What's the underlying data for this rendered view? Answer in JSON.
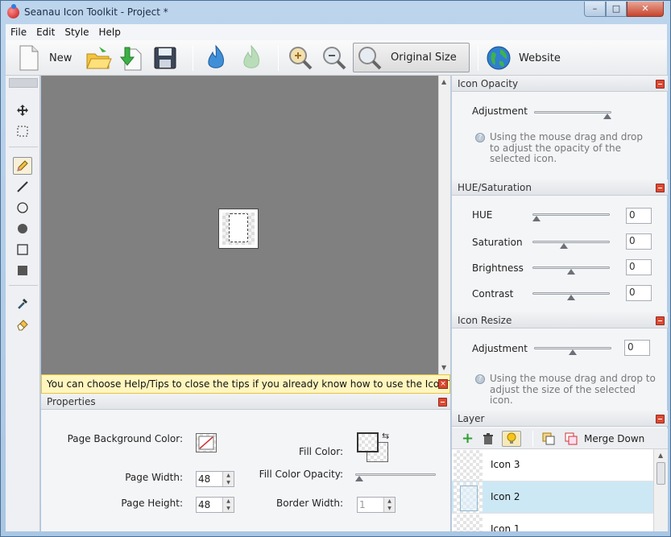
{
  "window": {
    "title": "Seanau Icon Toolkit - Project *",
    "min": "–",
    "max": "□",
    "close": "✕"
  },
  "menu": [
    "File",
    "Edit",
    "Style",
    "Help"
  ],
  "toolbar": {
    "new_label": "New",
    "original_size_label": "Original Size",
    "website_label": "Website"
  },
  "tips": {
    "text": "You can choose Help/Tips to close the tips if you already know how to use the Icon Toolkit.",
    "close": "×"
  },
  "properties": {
    "title": "Properties",
    "page_bg_label": "Page Background Color:",
    "page_width_label": "Page Width:",
    "page_width": "48",
    "page_height_label": "Page Height:",
    "page_height": "48",
    "fill_color_label": "Fill Color:",
    "fill_opacity_label": "Fill Color Opacity:",
    "fill_opacity": 0,
    "border_width_label": "Border Width:",
    "border_width": "1"
  },
  "icon_opacity": {
    "title": "Icon Opacity",
    "adjustment_label": "Adjustment",
    "value": 1.0,
    "info": "Using the mouse drag and drop to adjust the opacity of the selected icon."
  },
  "hue_saturation": {
    "title": "HUE/Saturation",
    "rows": [
      {
        "label": "HUE",
        "value": "0",
        "level": 0.0
      },
      {
        "label": "Saturation",
        "value": "0",
        "level": 0.4
      },
      {
        "label": "Brightness",
        "value": "0",
        "level": 0.5
      },
      {
        "label": "Contrast",
        "value": "0",
        "level": 0.5
      }
    ]
  },
  "icon_resize": {
    "title": "Icon Resize",
    "adjustment_label": "Adjustment",
    "value": "0",
    "level": 0.5,
    "info": "Using the mouse drag and drop to adjust the size of the selected icon."
  },
  "layer": {
    "title": "Layer",
    "merge_down_label": "Merge Down",
    "items": [
      "Icon 3",
      "Icon 2",
      "Icon 1"
    ],
    "selected_index": 1
  },
  "colors": {
    "accent": "#cde8f5",
    "close": "#dc4a33",
    "canvas": "#808080",
    "tips_bg": "#fff6be"
  }
}
